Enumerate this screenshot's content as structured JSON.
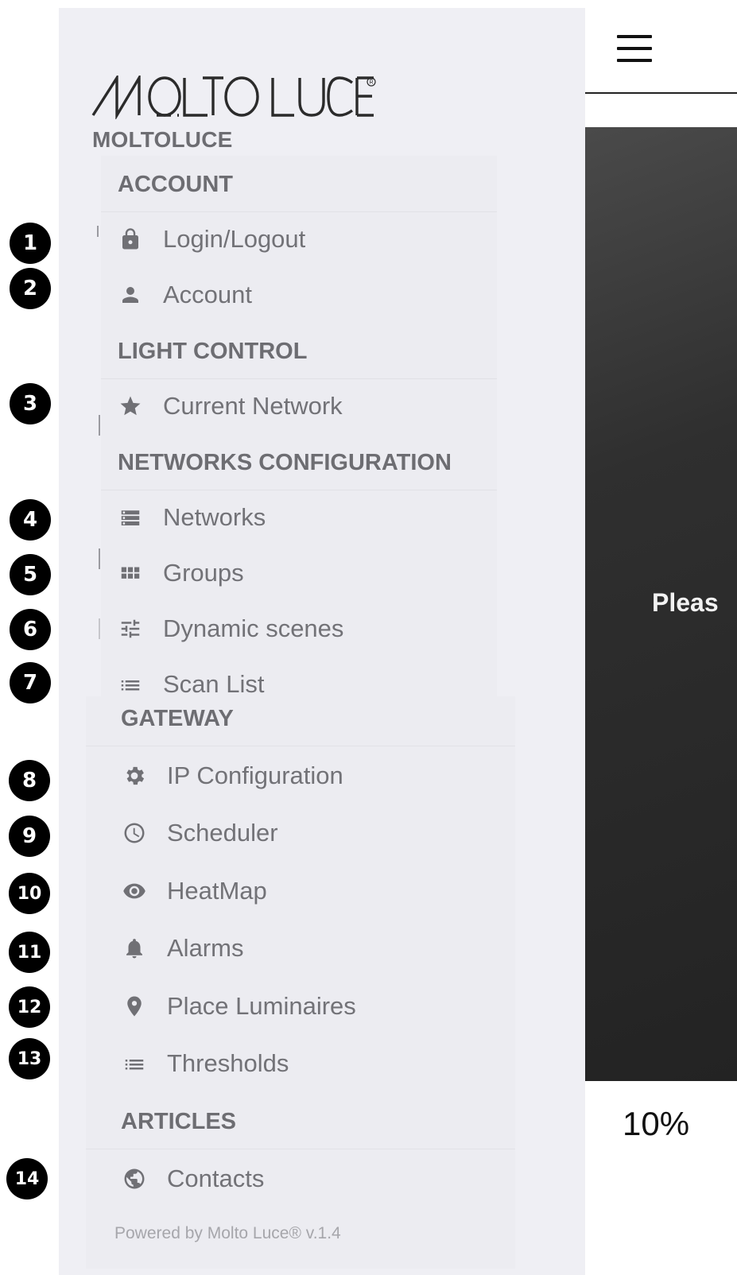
{
  "brand": {
    "logo_text": "MOLTO LUCE",
    "registered_mark": "®",
    "name": "MOLTOLUCE"
  },
  "sections": {
    "account": "ACCOUNT",
    "light_control": "LIGHT CONTROL",
    "networks_configuration": "NETWORKS CONFIGURATION",
    "gateway": "GATEWAY",
    "articles": "ARTICLES"
  },
  "menu": {
    "login_logout": {
      "label": "Login/Logout",
      "icon": "lock-icon"
    },
    "account": {
      "label": "Account",
      "icon": "person-icon"
    },
    "current_network": {
      "label": "Current Network",
      "icon": "star-icon"
    },
    "networks": {
      "label": "Networks",
      "icon": "list-boxes-icon"
    },
    "groups": {
      "label": "Groups",
      "icon": "grid-icon"
    },
    "dynamic_scenes": {
      "label": "Dynamic scenes",
      "icon": "sliders-icon"
    },
    "scan_list": {
      "label": "Scan List",
      "icon": "list-icon"
    },
    "ip_configuration": {
      "label": "IP Configuration",
      "icon": "gear-icon"
    },
    "scheduler": {
      "label": "Scheduler",
      "icon": "clock-icon"
    },
    "heatmap": {
      "label": "HeatMap",
      "icon": "eye-icon"
    },
    "alarms": {
      "label": "Alarms",
      "icon": "bell-icon"
    },
    "place_luminaires": {
      "label": "Place Luminaires",
      "icon": "map-pin-icon"
    },
    "thresholds": {
      "label": "Thresholds",
      "icon": "list-icon"
    },
    "contacts": {
      "label": "Contacts",
      "icon": "globe-icon"
    }
  },
  "badges": [
    "1",
    "2",
    "3",
    "4",
    "5",
    "6",
    "7",
    "8",
    "9",
    "10",
    "11",
    "12",
    "13",
    "14"
  ],
  "footer": "Powered by Molto Luce® v.1.4",
  "main": {
    "partial_text": "Pleas",
    "percent": "10%"
  },
  "colors": {
    "panel": "#ececf1",
    "screen_bg": "#efeff4",
    "text_gray": "#727277",
    "badge": "#000000"
  }
}
